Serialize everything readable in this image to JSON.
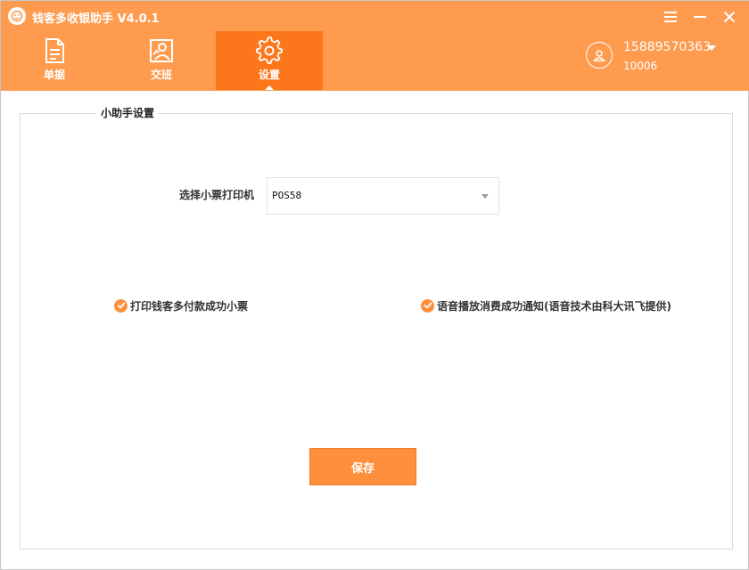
{
  "window": {
    "title": "钱客多收银助手 V4.0.1",
    "accent_color": "#fe9b4f",
    "active_tab_color": "#fc771c"
  },
  "tabs": [
    {
      "label": "单据",
      "icon": "document-icon",
      "active": false
    },
    {
      "label": "交班",
      "icon": "shift-handover-icon",
      "active": false
    },
    {
      "label": "设置",
      "icon": "gear-icon",
      "active": true
    }
  ],
  "user": {
    "phone": "15889570363",
    "id": "10006"
  },
  "settings": {
    "section_title": "小助手设置",
    "printer_label": "选择小票打印机",
    "printer_value": "POS58",
    "options": [
      {
        "label": "打印钱客多付款成功小票",
        "checked": true
      },
      {
        "label": "语音播放消费成功通知(语音技术由科大讯飞提供)",
        "checked": true
      }
    ],
    "save_label": "保存"
  }
}
